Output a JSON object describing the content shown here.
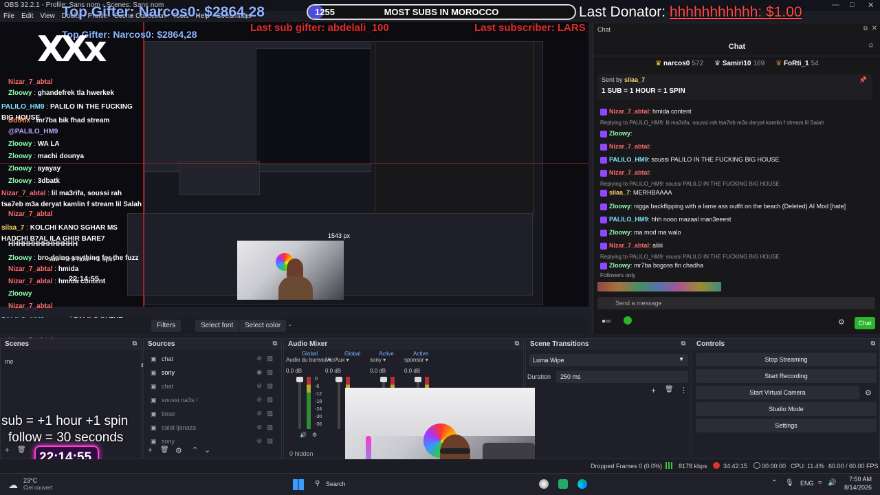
{
  "window": {
    "title": "OBS 32.2.1 - Profile: Sans nom - Scenes: Sans nom"
  },
  "menu": [
    "File",
    "Edit",
    "View",
    "Docks",
    "Profile",
    "Scene Collection",
    "Tools",
    "Help",
    "Streamlabs"
  ],
  "overlay": {
    "top_gifter_label": "Top Gifter: Narcos0: $2864,28",
    "goal_count": "1255",
    "goal_text": "MOST SUBS IN MOROCCO",
    "goal_progress": 0.06,
    "last_donator_label": "Last Donator:",
    "last_donator_value": "hhhhhhhhhhh: $1.00",
    "last_sub_gifter": "Last sub gifter: abdelali_100",
    "last_subscriber": "Last subscriber: LARS_abidou_y",
    "logo_text": "XXx",
    "sub_info": "sub  = +1 hour +1 spin",
    "follow_info": "follow = 30 seconds",
    "timer": "22:14:55",
    "nested_px": "1543 px"
  },
  "left_chat": [
    {
      "user": "Nizar_7_abtal",
      "text": "",
      "color": "#ff6b6b"
    },
    {
      "user": "Zloowy",
      "text": "ghandefrek tla hwerkek",
      "color": "#8fffb0"
    },
    {
      "user": "PALILO_HM9",
      "text": "PALILO IN THE FUCKING BIG HOUSE",
      "color": "#7de0ff"
    },
    {
      "user": "BotRix",
      "text": "mr7ba bik fhad stream",
      "color": "#ff8c5a"
    },
    {
      "user": "@PALILO_HM9",
      "text": "",
      "color": "#b9a9ff"
    },
    {
      "user": "Zloowy",
      "text": "WA LA",
      "color": "#8fffb0"
    },
    {
      "user": "Zloowy",
      "text": "machi dounya",
      "color": "#8fffb0"
    },
    {
      "user": "Zloowy",
      "text": "ayayay",
      "color": "#8fffb0"
    },
    {
      "user": "Zloowy",
      "text": "3dbatk",
      "color": "#8fffb0"
    },
    {
      "user": "Nizar_7_abtal",
      "text": "lil ma3rifa, soussi rah tsa7eb m3a deryat kamlin f stream lil Salah",
      "color": "#ff6b6b"
    },
    {
      "user": "Nizar_7_abtal",
      "text": "",
      "color": "#ff6b6b"
    },
    {
      "user": "silaa_7",
      "text": "KOLCHI KANO SGHAR MS HADCHI B7AL ILA GHIR BARE7",
      "color": "#ffd166"
    },
    {
      "user": "",
      "text": "HHHHHHHHHHHHHH",
      "color": "#fff"
    },
    {
      "user": "Zloowy",
      "text": "bro doing anything for the fuzz",
      "color": "#8fffb0"
    },
    {
      "user": "Nizar_7_abtal",
      "text": "hmida",
      "color": "#ff6b6b"
    },
    {
      "user": "Nizar_7_abtal",
      "text": "hmida content",
      "color": "#ff6b6b"
    },
    {
      "user": "Zloowy",
      "text": "",
      "color": "#8fffb0"
    },
    {
      "user": "Nizar_7_abtal",
      "text": "",
      "color": "#ff6b6b"
    },
    {
      "user": "PALILO_HM9",
      "text": "soussi PALILO IN THE FUCKING BIG HOUSE",
      "color": "#7de0ff"
    },
    {
      "user": "Nizar_7_abtal",
      "text": "",
      "color": "#ff6b6b"
    },
    {
      "user": "silaa_7",
      "text": "MERHBAAAA",
      "color": "#ffd166"
    },
    {
      "user": "PALILO_HM9",
      "text": "hhh nooo mazaal man3eeest",
      "color": "#7de0ff"
    },
    {
      "user": "Zloowy",
      "text": "ma mod ma walo",
      "color": "#8fffb0"
    },
    {
      "user": "Nizar_7_abtal",
      "text": "aliiii",
      "color": "#ff6b6b"
    },
    {
      "user": "Zloowy",
      "text": "mr7ba bogoss fin chadha",
      "color": "#8fffb0"
    }
  ],
  "chat_dock": {
    "title": "Chat",
    "popout": "Chat",
    "top": [
      {
        "name": "narcos0",
        "count": "572"
      },
      {
        "name": "Samiri10",
        "count": "169"
      },
      {
        "name": "FoRti_1",
        "count": "54"
      }
    ],
    "pinned_by": "Sent by",
    "pinned_user": "silaa_7",
    "pinned_text": "1 SUB = 1 HOUR = 1 SPIN",
    "messages": [
      {
        "kind": "msg",
        "user": "Nizar_7_abtal",
        "text": ": hmida content",
        "color": "#ff6b6b"
      },
      {
        "kind": "reply",
        "text": "Replying to PALILO_HM9: lil ma3rifa, soussi rah tsa7eb m3a deryat kamlin f stream lil Salah"
      },
      {
        "kind": "msg",
        "user": "Zloowy",
        "text": ":",
        "color": "#8fffb0"
      },
      {
        "kind": "msg",
        "user": "Nizar_7_abtal",
        "text": ":",
        "color": "#ff6b6b"
      },
      {
        "kind": "msg",
        "user": "PALILO_HM9",
        "text": ": soussi PALILO IN THE FUCKING BIG HOUSE",
        "color": "#7de0ff"
      },
      {
        "kind": "msg",
        "user": "Nizar_7_abtal",
        "text": ":",
        "color": "#ff6b6b"
      },
      {
        "kind": "reply",
        "text": "Replying to PALILO_HM9: soussi PALILO IN THE FUCKING BIG HOUSE"
      },
      {
        "kind": "msg",
        "user": "silaa_7",
        "text": ": MERHBAAAA",
        "color": "#ffd166"
      },
      {
        "kind": "msg",
        "user": "Zloowy",
        "text": ": nigga backflipping with a lame ass outfit on the beach (Deleted) AI Mod [hate]",
        "color": "#8fffb0"
      },
      {
        "kind": "msg",
        "user": "PALILO_HM9",
        "text": ": hhh nooo mazaal man3eeest",
        "color": "#7de0ff"
      },
      {
        "kind": "msg",
        "user": "Zloowy",
        "text": ": ma mod ma walo",
        "color": "#8fffb0"
      },
      {
        "kind": "msg",
        "user": "Nizar_7_abtal",
        "text": ": aliiii",
        "color": "#ff6b6b"
      },
      {
        "kind": "reply",
        "text": "Replying to PALILO_HM9: soussi PALILO IN THE FUCKING BIG HOUSE"
      },
      {
        "kind": "msg",
        "user": "Zloowy",
        "text": ": mr7ba bogoss fin chadha",
        "color": "#8fffb0"
      }
    ],
    "followers_only": "Followers only",
    "input_placeholder": "Send a message",
    "chat_button": "Chat"
  },
  "toolbar": {
    "filters": "Filters",
    "select_font": "Select font",
    "select_color": "Select color",
    "dash": "-"
  },
  "scenes": {
    "title": "Scenes",
    "items": [
      "me"
    ]
  },
  "sources": {
    "title": "Sources",
    "items": [
      "chat",
      "sony",
      "chat",
      "soussi na3s !",
      "timer",
      "salat ljanaza",
      "sony"
    ]
  },
  "mixer": {
    "title": "Audio Mixer",
    "headers": [
      "Global",
      "Global",
      "Active",
      "Active"
    ],
    "channels": [
      {
        "name": "Audio du bureau",
        "db": "0.0 dB"
      },
      {
        "name": "Mic/Aux",
        "db": "0.0 dB"
      },
      {
        "name": "sony",
        "db": "0.0 dB"
      },
      {
        "name": "sponsor",
        "db": "0.0 dB"
      }
    ],
    "hidden": "0 hidden",
    "scale": [
      "0",
      "-6",
      "-12",
      "-18",
      "-24",
      "-30",
      "-36"
    ]
  },
  "transitions": {
    "title": "Scene Transitions",
    "type": "Luma Wipe",
    "duration_label": "Duration",
    "duration": "250 ms"
  },
  "controls": {
    "title": "Controls",
    "buttons": [
      "Stop Streaming",
      "Start Recording",
      "Start Virtual Camera",
      "Studio Mode",
      "Settings"
    ]
  },
  "status": {
    "dropped": "Dropped Frames 0 (0.0%)",
    "kbps": "8178 kbps",
    "live": "34:42:15",
    "rec": "00:00:00",
    "cpu": "CPU: 11.4%",
    "fps": "60.00 / 60.00 FPS"
  },
  "taskbar": {
    "temp": "23°C",
    "weather": "Ciel couvert",
    "search": "Search",
    "lang": "ENG",
    "time": "7:50 AM",
    "date": "8/14/2026"
  }
}
